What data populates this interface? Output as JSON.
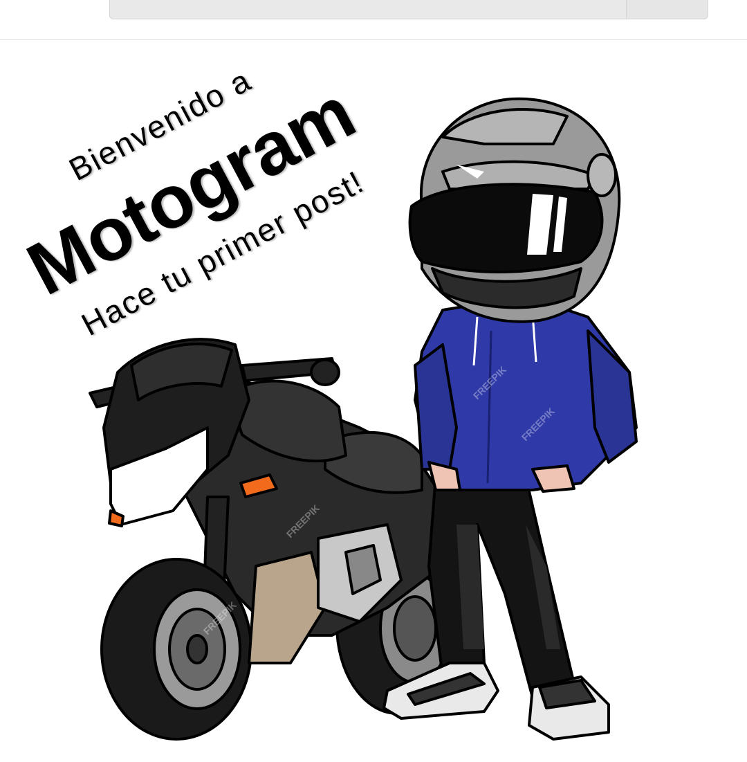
{
  "search": {
    "placeholder": ""
  },
  "welcome": {
    "line1": "Bienvenido a",
    "line2": "Motogram",
    "line3": "Hace tu primer post!"
  },
  "watermark": "FREEPIK",
  "colors": {
    "hoodie": "#2f3aa8",
    "helmet": "#9a9a9a",
    "visor": "#0b0b0b",
    "bike": "#1f1f1f",
    "indicator": "#f26b1d"
  }
}
